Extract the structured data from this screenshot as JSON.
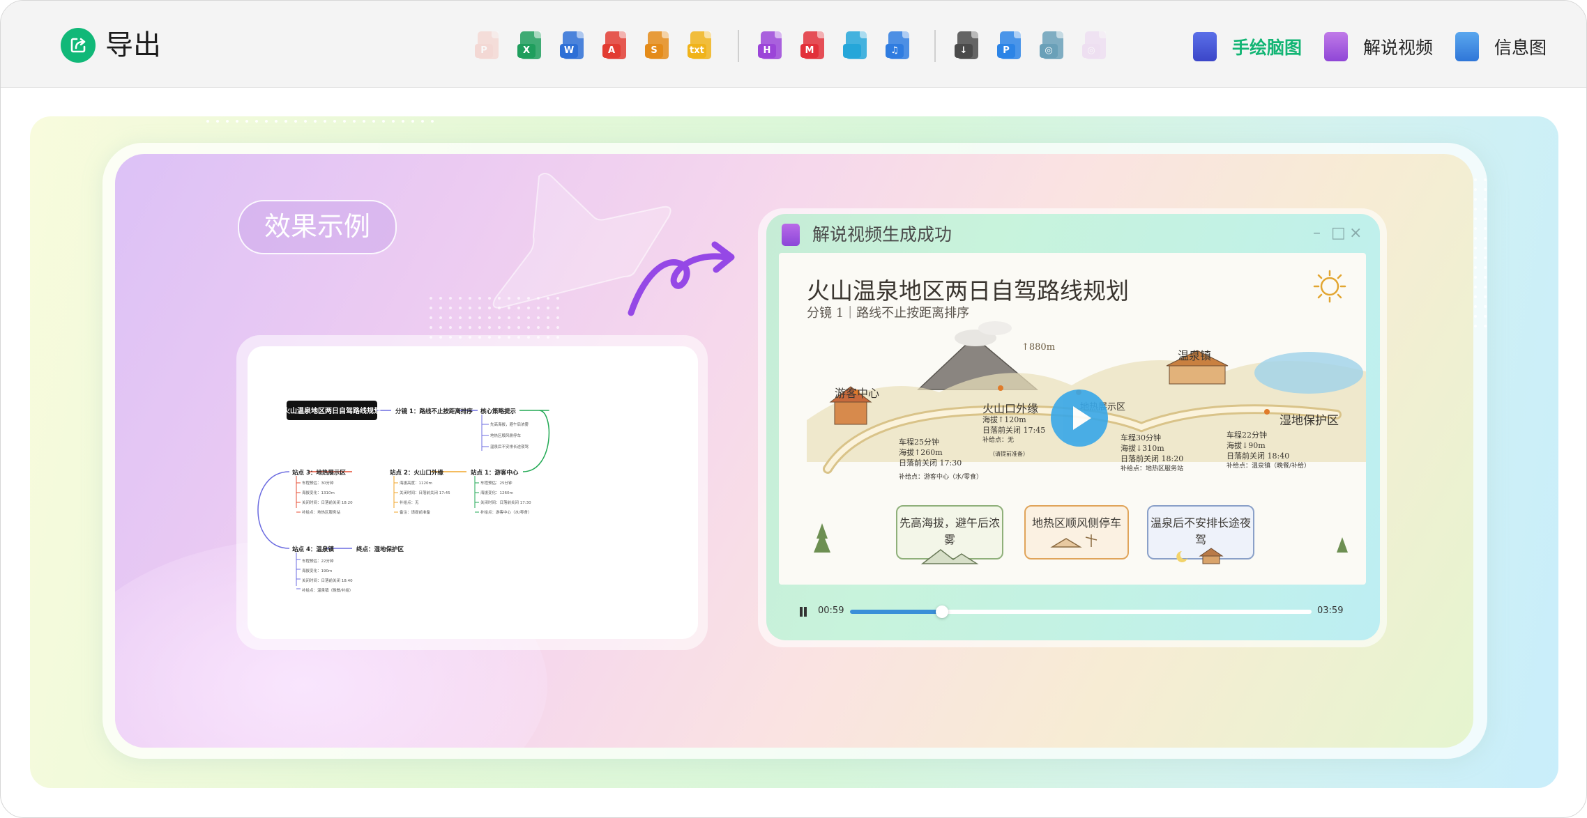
{
  "app": {
    "title": "导出"
  },
  "colors": {
    "accent": "#11b878",
    "progress": "#3a8fd8"
  },
  "formats_group1": [
    {
      "label": "P",
      "icon": "ppt-file-icon",
      "color": "#f3b8ae",
      "faded": true
    },
    {
      "label": "X",
      "icon": "excel-file-icon",
      "color": "#1f9e5d"
    },
    {
      "label": "W",
      "icon": "word-file-icon",
      "color": "#2d6fd6"
    },
    {
      "label": "A",
      "icon": "pdf-file-icon",
      "color": "#e23c32"
    },
    {
      "label": "S",
      "icon": "slides-file-icon",
      "color": "#e48b19"
    },
    {
      "label": "txt",
      "icon": "txt-file-icon",
      "color": "#f0b31a"
    }
  ],
  "formats_group2": [
    {
      "label": "H",
      "icon": "html-file-icon",
      "color": "#9b45d8"
    },
    {
      "label": "M",
      "icon": "markdown-file-icon",
      "color": "#e2303a"
    },
    {
      "label": "",
      "icon": "image-file-icon",
      "color": "#25a6d9"
    },
    {
      "label": "♫",
      "icon": "audio-file-icon",
      "color": "#2f7ce0"
    }
  ],
  "formats_group3": [
    {
      "label": "↓",
      "icon": "download-file-icon",
      "color": "#4a4a4a"
    },
    {
      "label": "P",
      "icon": "p-file-icon",
      "color": "#2c84e6"
    },
    {
      "label": "◎",
      "icon": "disc-file-icon",
      "color": "#6aa0b8"
    },
    {
      "label": "◎",
      "icon": "video-file-icon",
      "color": "#e7c6ee",
      "faded": true
    }
  ],
  "modes": [
    {
      "label": "手绘脑图",
      "icon": "hand-drawn-mindmap-icon",
      "active": true
    },
    {
      "label": "解说视频",
      "icon": "narration-video-icon",
      "active": false
    },
    {
      "label": "信息图",
      "icon": "infographic-icon",
      "active": false
    }
  ],
  "example_label": "效果示例",
  "mindmap": {
    "root": "火山温泉地区两日自驾路线规划",
    "branch1": "分镜 1：路线不止按距离排序",
    "strategy": {
      "title": "核心策略提示",
      "items": [
        "先高海拔，避午后浓雾",
        "地热区顺风侧停车",
        "温泉后不安排长途夜驾"
      ]
    },
    "stop1": {
      "title": "站点 1：游客中心",
      "items": [
        "车程预估：25分钟",
        "海拔变化：1260m",
        "关闭时间：日落前关闭 17:30",
        "补给点：游客中心（水/零食）"
      ]
    },
    "stop2": {
      "title": "站点 2：火山口外缘",
      "items": [
        "海拔高度：1120m",
        "关闭时间：日落前关闭 17:45",
        "补给点：无",
        "备注：请提前准备"
      ]
    },
    "stop3": {
      "title": "站点 3：地热展示区",
      "items": [
        "车程预估：30分钟",
        "海拔变化：1310m",
        "关闭时间：日落前关闭 18:20",
        "补给点：地热区服务站"
      ]
    },
    "stop4": {
      "title": "站点 4：温泉镇",
      "items": [
        "车程预估：22分钟",
        "海拔变化：190m",
        "关闭时间：日落前关闭 18:40",
        "补给点：温泉镇（晚餐/补给）"
      ]
    },
    "terminal": "终点：湿地保护区"
  },
  "video": {
    "window_title": "解说视频生成成功",
    "scene_title": "火山温泉地区两日自驾路线规划",
    "scene_subtitle": "分镜 1｜路线不止按距离排序",
    "labels": {
      "visitor": "游客中心",
      "crater": "火山口外缘",
      "geo": "地热展示区",
      "town": "温泉镇",
      "wetland": "湿地保护区",
      "alt880": "↑880m"
    },
    "notes": {
      "n1": [
        "车程25分钟",
        "海拔↑260m",
        "日落前关闭 17:30"
      ],
      "n1b": "补给点：游客中心（水/零食）",
      "n2": [
        "海拔↑120m",
        "日落前关闭 17:45",
        "补给点：无"
      ],
      "n2b": "（请提前准备）",
      "n3": [
        "车程30分钟",
        "海拔↓310m",
        "日落前关闭 18:20",
        "补给点：地热区服务站"
      ],
      "n4": [
        "车程22分钟",
        "海拔↓90m",
        "日落前关闭 18:40",
        "补给点：温泉镇（晚餐/补给）"
      ]
    },
    "tips": [
      "先高海拔，避午后浓雾",
      "地热区顺风侧停车",
      "温泉后不安排长途夜驾"
    ],
    "time_current": "00:59",
    "time_total": "03:59",
    "progress": 0.2
  }
}
